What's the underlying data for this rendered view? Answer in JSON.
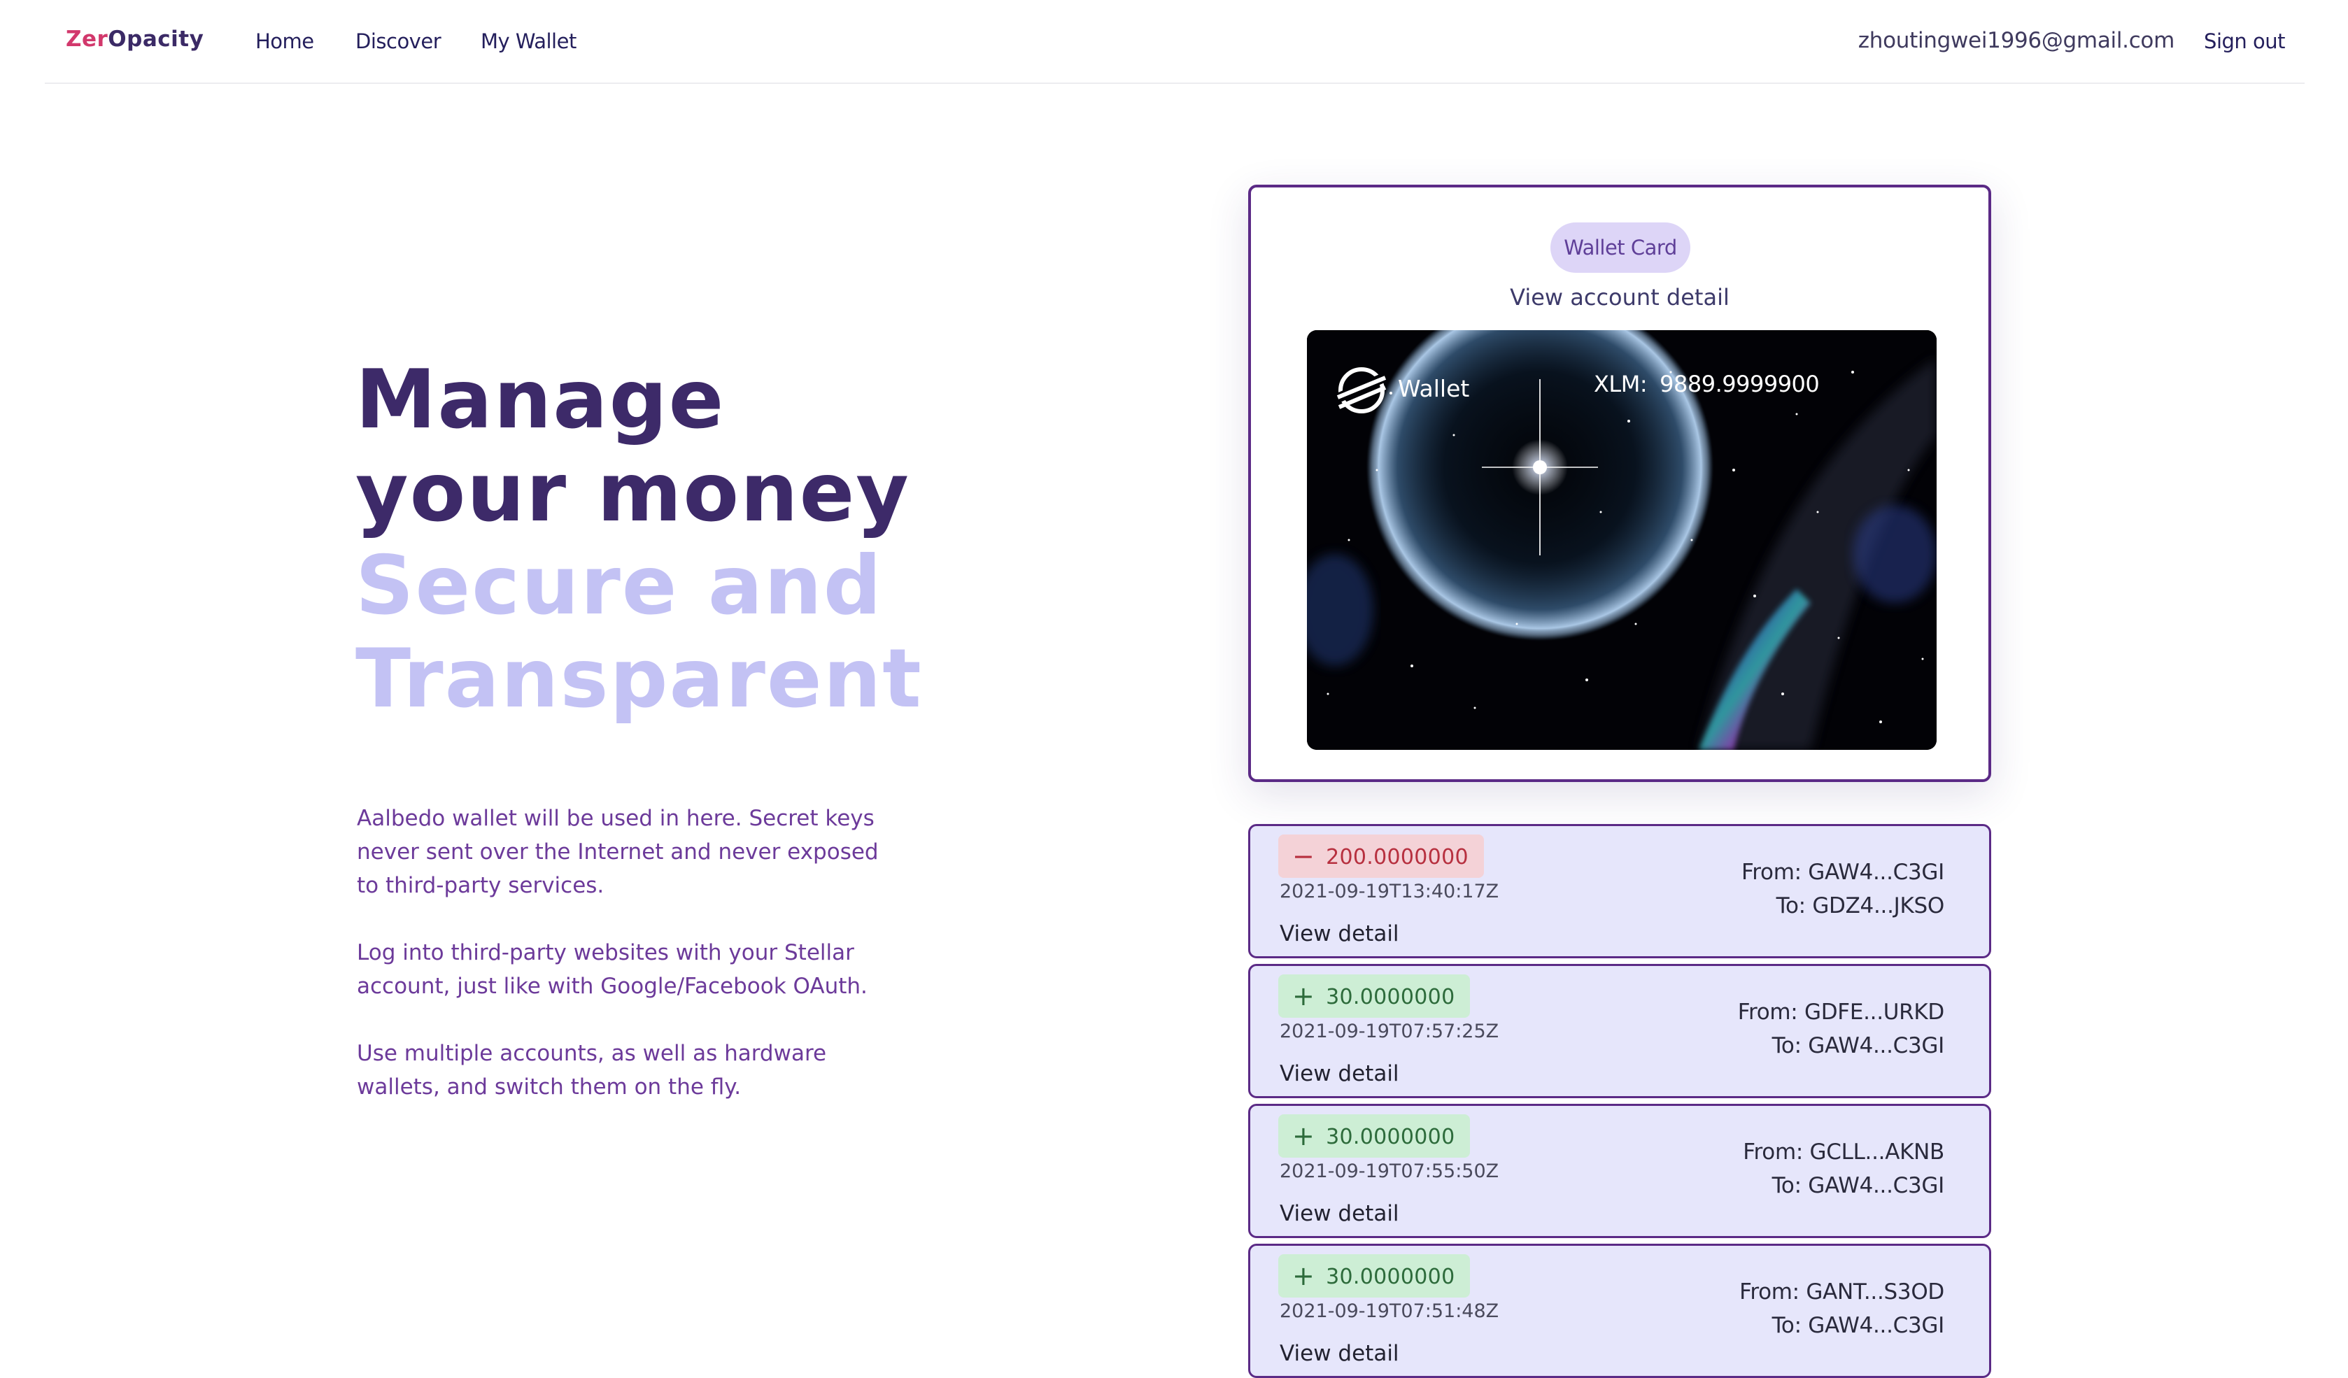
{
  "brand": {
    "part1": "Zer",
    "part2": "Opacity"
  },
  "nav": {
    "links": [
      "Home",
      "Discover",
      "My Wallet"
    ],
    "email": "zhoutingwei1996@gmail.com",
    "signout": "Sign out"
  },
  "hero": {
    "line1": "Manage",
    "line2": "your money",
    "line3": "Secure and",
    "line4": "Transparent",
    "paragraphs": [
      "Aalbedo wallet will be used in here. Secret keys never sent over the Internet and never exposed to third-party services.",
      "Log into third-party websites with your Stellar account, just like with Google/Facebook OAuth.",
      "Use multiple accounts, as well as hardware wallets, and switch them on the fly."
    ]
  },
  "wallet": {
    "badge": "Wallet Card",
    "view_account": "View account detail",
    "card_label": "Wallet",
    "xlm_label": "XLM:",
    "xlm_value": "9889.9999900",
    "logo_icon": "stellar-logo-icon"
  },
  "transactions": [
    {
      "sign": "−",
      "kind": "neg",
      "amount": "200.0000000",
      "time": "2021-09-19T13:40:17Z",
      "detail": "View detail",
      "from": "From: GAW4...C3GI",
      "to": "To: GDZ4...JKSO"
    },
    {
      "sign": "+",
      "kind": "pos",
      "amount": "30.0000000",
      "time": "2021-09-19T07:57:25Z",
      "detail": "View detail",
      "from": "From: GDFE...URKD",
      "to": "To: GAW4...C3GI"
    },
    {
      "sign": "+",
      "kind": "pos",
      "amount": "30.0000000",
      "time": "2021-09-19T07:55:50Z",
      "detail": "View detail",
      "from": "From: GCLL...AKNB",
      "to": "To: GAW4...C3GI"
    },
    {
      "sign": "+",
      "kind": "pos",
      "amount": "30.0000000",
      "time": "2021-09-19T07:51:48Z",
      "detail": "View detail",
      "from": "From: GANT...S3OD",
      "to": "To: GAW4...C3GI"
    }
  ],
  "colors": {
    "brand_pink": "#d2386c",
    "title_dark": "#3d2a69",
    "title_light": "#c3c2f4",
    "accent_purple": "#5b2a86",
    "tx_background": "#e6e6fb",
    "negative_badge": "#f4d2d7",
    "positive_badge": "#cdeed5"
  }
}
